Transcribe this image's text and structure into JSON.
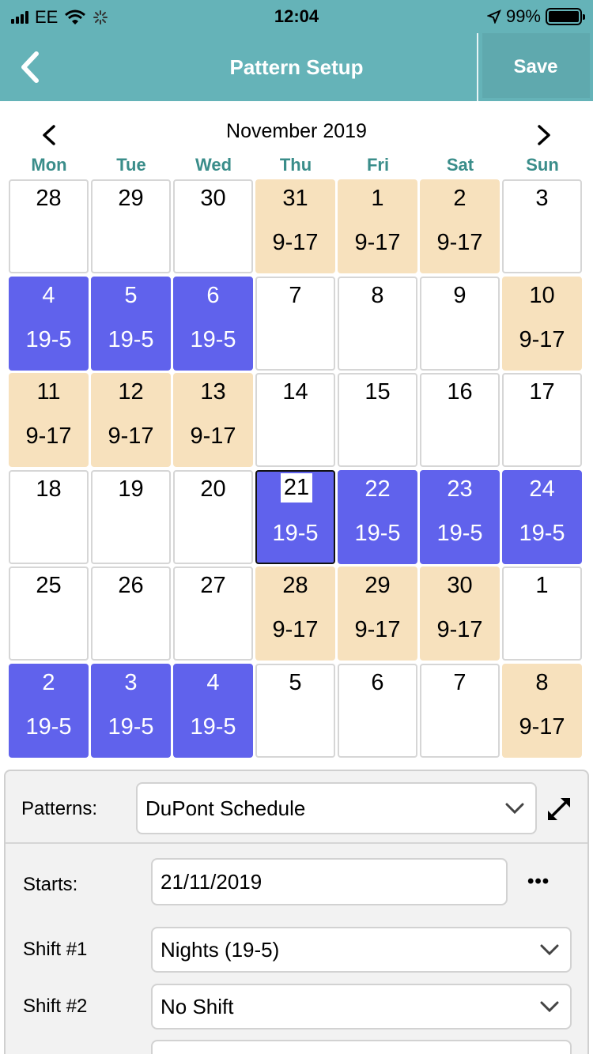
{
  "status_bar": {
    "carrier": "EE",
    "time": "12:04",
    "battery": "99%"
  },
  "nav": {
    "title": "Pattern Setup",
    "save_label": "Save"
  },
  "calendar": {
    "month_label": "November 2019",
    "weekdays": [
      "Mon",
      "Tue",
      "Wed",
      "Thu",
      "Fri",
      "Sat",
      "Sun"
    ],
    "weeks": [
      [
        {
          "day": "28",
          "shift": "",
          "type": "none"
        },
        {
          "day": "29",
          "shift": "",
          "type": "none"
        },
        {
          "day": "30",
          "shift": "",
          "type": "none"
        },
        {
          "day": "31",
          "shift": "9-17",
          "type": "day"
        },
        {
          "day": "1",
          "shift": "9-17",
          "type": "day"
        },
        {
          "day": "2",
          "shift": "9-17",
          "type": "day"
        },
        {
          "day": "3",
          "shift": "",
          "type": "none"
        }
      ],
      [
        {
          "day": "4",
          "shift": "19-5",
          "type": "night"
        },
        {
          "day": "5",
          "shift": "19-5",
          "type": "night"
        },
        {
          "day": "6",
          "shift": "19-5",
          "type": "night"
        },
        {
          "day": "7",
          "shift": "",
          "type": "none"
        },
        {
          "day": "8",
          "shift": "",
          "type": "none"
        },
        {
          "day": "9",
          "shift": "",
          "type": "none"
        },
        {
          "day": "10",
          "shift": "9-17",
          "type": "day"
        }
      ],
      [
        {
          "day": "11",
          "shift": "9-17",
          "type": "day"
        },
        {
          "day": "12",
          "shift": "9-17",
          "type": "day"
        },
        {
          "day": "13",
          "shift": "9-17",
          "type": "day"
        },
        {
          "day": "14",
          "shift": "",
          "type": "none"
        },
        {
          "day": "15",
          "shift": "",
          "type": "none"
        },
        {
          "day": "16",
          "shift": "",
          "type": "none"
        },
        {
          "day": "17",
          "shift": "",
          "type": "none"
        }
      ],
      [
        {
          "day": "18",
          "shift": "",
          "type": "none"
        },
        {
          "day": "19",
          "shift": "",
          "type": "none"
        },
        {
          "day": "20",
          "shift": "",
          "type": "none"
        },
        {
          "day": "21",
          "shift": "19-5",
          "type": "night",
          "selected": true
        },
        {
          "day": "22",
          "shift": "19-5",
          "type": "night"
        },
        {
          "day": "23",
          "shift": "19-5",
          "type": "night"
        },
        {
          "day": "24",
          "shift": "19-5",
          "type": "night"
        }
      ],
      [
        {
          "day": "25",
          "shift": "",
          "type": "none"
        },
        {
          "day": "26",
          "shift": "",
          "type": "none"
        },
        {
          "day": "27",
          "shift": "",
          "type": "none"
        },
        {
          "day": "28",
          "shift": "9-17",
          "type": "day"
        },
        {
          "day": "29",
          "shift": "9-17",
          "type": "day"
        },
        {
          "day": "30",
          "shift": "9-17",
          "type": "day"
        },
        {
          "day": "1",
          "shift": "",
          "type": "none"
        }
      ],
      [
        {
          "day": "2",
          "shift": "19-5",
          "type": "night"
        },
        {
          "day": "3",
          "shift": "19-5",
          "type": "night"
        },
        {
          "day": "4",
          "shift": "19-5",
          "type": "night"
        },
        {
          "day": "5",
          "shift": "",
          "type": "none"
        },
        {
          "day": "6",
          "shift": "",
          "type": "none"
        },
        {
          "day": "7",
          "shift": "",
          "type": "none"
        },
        {
          "day": "8",
          "shift": "9-17",
          "type": "day"
        }
      ]
    ]
  },
  "form": {
    "patterns_label": "Patterns:",
    "patterns_value": "DuPont Schedule",
    "starts_label": "Starts:",
    "starts_value": "21/11/2019",
    "more_label": "•••",
    "shift1_label": "Shift #1",
    "shift1_value": "Nights (19-5)",
    "shift2_label": "Shift #2",
    "shift2_value": "No Shift"
  },
  "colors": {
    "header": "#65b3b8",
    "weekday": "#3a8d8a",
    "day_shift": "#f7e1bd",
    "night_shift": "#6062ec"
  },
  "icons": [
    "back-chevron-icon",
    "prev-month-icon",
    "next-month-icon",
    "expand-icon",
    "chevron-down-icon",
    "wifi-icon",
    "location-icon",
    "battery-icon"
  ]
}
